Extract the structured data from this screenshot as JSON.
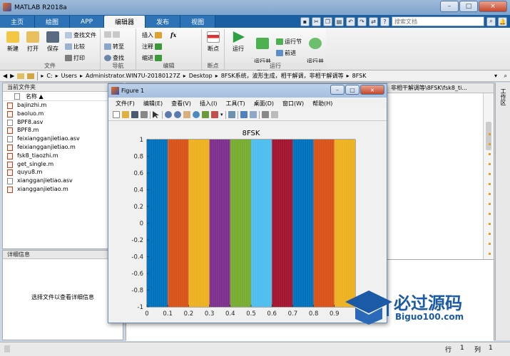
{
  "window": {
    "title": "MATLAB R2018a",
    "controls": [
      "–",
      "□",
      "×"
    ]
  },
  "tabs": [
    {
      "label": "主页"
    },
    {
      "label": "绘图"
    },
    {
      "label": "APP"
    },
    {
      "label": "编辑器",
      "active": true
    },
    {
      "label": "发布"
    },
    {
      "label": "视图"
    }
  ],
  "search": {
    "placeholder": "搜索文档"
  },
  "ribbon": {
    "file": {
      "label": "文件",
      "new": "新建",
      "open": "打开",
      "save": "保存",
      "find_files": "查找文件",
      "compare": "比较",
      "print": "打印"
    },
    "navigate": {
      "label": "导航",
      "goto": "转至",
      "find": "查找"
    },
    "edit": {
      "label": "编辑",
      "insert": "插入",
      "comment": "注释",
      "indent": "缩进",
      "fx": "fx"
    },
    "breakpoints": {
      "label": "断点",
      "btn": "断点"
    },
    "run": {
      "label": "运行",
      "run": "运行",
      "run_advance": "运行并\n前进",
      "run_section": "运行节",
      "advance": "前进",
      "run_time": "运行并\n计时"
    }
  },
  "address": {
    "segments": [
      "C:",
      "Users",
      "Administrator.WIN7U-20180127Z",
      "Desktop",
      "8FSK系统，波形生成，相干解调，非相干解调等",
      "8FSK"
    ]
  },
  "file_panel": {
    "title": "当前文件夹",
    "column": "名称 ▲",
    "files": [
      {
        "name": "bajinzhi.m",
        "type": "m"
      },
      {
        "name": "baoluo.m",
        "type": "m"
      },
      {
        "name": "BPF8.asv",
        "type": "asv"
      },
      {
        "name": "BPF8.m",
        "type": "m"
      },
      {
        "name": "feixiangganjietiao.asv",
        "type": "asv"
      },
      {
        "name": "feixiangganjietiao.m",
        "type": "m"
      },
      {
        "name": "fsk8_tiaozhi.m",
        "type": "m"
      },
      {
        "name": "get_single.m",
        "type": "m"
      },
      {
        "name": "quyu8.m",
        "type": "m"
      },
      {
        "name": "xiangganjietiao.asv",
        "type": "asv"
      },
      {
        "name": "xiangganjietiao.m",
        "type": "m"
      }
    ]
  },
  "details_panel": {
    "title": "详细信息",
    "hint": "选择文件以查看详细信息"
  },
  "editor_path": "，非相干解调等\\8FSK\\fsk8_ti...",
  "workspace_label": "工作区",
  "figure": {
    "title": "Figure 1",
    "menu": [
      "文件(F)",
      "编辑(E)",
      "查看(V)",
      "插入(I)",
      "工具(T)",
      "桌面(D)",
      "窗口(W)",
      "帮助(H)"
    ]
  },
  "status": {
    "row_label": "行",
    "row_value": "1",
    "col_label": "列",
    "col_value": "1"
  },
  "watermark": {
    "brand": "必过源码",
    "site": "Biguo100.com"
  },
  "chart_data": {
    "type": "area",
    "title": "8FSK",
    "xlim": [
      0,
      1
    ],
    "ylim": [
      -1,
      1
    ],
    "xticks": [
      0,
      0.1,
      0.2,
      0.3,
      0.4,
      0.5,
      0.6,
      0.7,
      0.8,
      0.9
    ],
    "xtick_labels": [
      "0",
      "0.1",
      "0.2",
      "0.3",
      "0.4",
      "0.5",
      "0.6",
      "0.7",
      "0.8",
      "0.9"
    ],
    "yticks": [
      -1,
      -0.8,
      -0.6,
      -0.4,
      -0.2,
      0,
      0.2,
      0.4,
      0.6,
      0.8,
      1
    ],
    "ytick_labels": [
      "-1",
      "-0.8",
      "-0.6",
      "-0.4",
      "-0.2",
      "0",
      "0.2",
      "0.4",
      "0.6",
      "0.8",
      "1"
    ],
    "grid": false,
    "segments": [
      {
        "x0": 0,
        "x1": 0.1,
        "amplitude": 1,
        "color": "#0072bd"
      },
      {
        "x0": 0.1,
        "x1": 0.2,
        "amplitude": 1,
        "color": "#d95319"
      },
      {
        "x0": 0.2,
        "x1": 0.3,
        "amplitude": 1,
        "color": "#edb120"
      },
      {
        "x0": 0.3,
        "x1": 0.4,
        "amplitude": 1,
        "color": "#7e2f8e"
      },
      {
        "x0": 0.4,
        "x1": 0.5,
        "amplitude": 1,
        "color": "#77ac30"
      },
      {
        "x0": 0.5,
        "x1": 0.6,
        "amplitude": 1,
        "color": "#4dbeee"
      },
      {
        "x0": 0.6,
        "x1": 0.7,
        "amplitude": 1,
        "color": "#a2142f"
      },
      {
        "x0": 0.7,
        "x1": 0.8,
        "amplitude": 1,
        "color": "#0072bd"
      },
      {
        "x0": 0.8,
        "x1": 0.9,
        "amplitude": 1,
        "color": "#d95319"
      },
      {
        "x0": 0.9,
        "x1": 1.0,
        "amplitude": 1,
        "color": "#edb120"
      }
    ]
  }
}
